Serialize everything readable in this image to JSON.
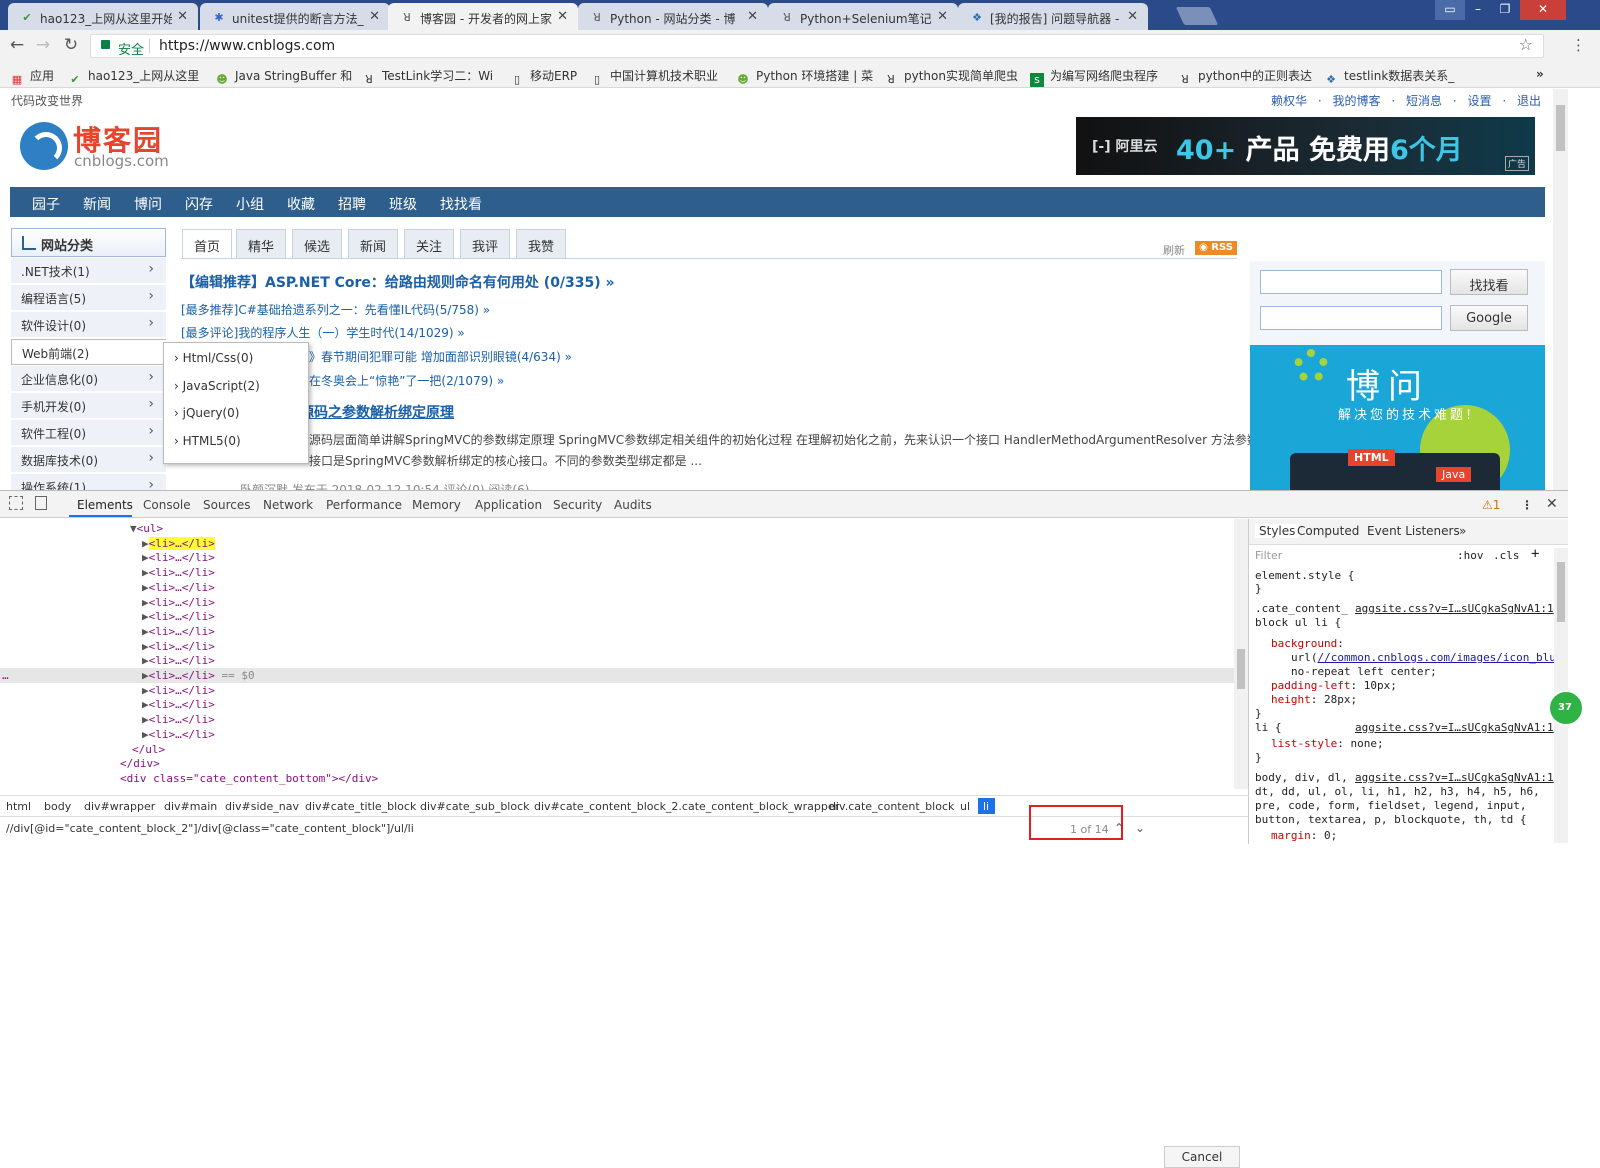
{
  "browser": {
    "tabs": [
      {
        "title": "hao123_上网从这里开始",
        "icon": "hao123-icon"
      },
      {
        "title": "unitest提供的断言方法_",
        "icon": "baidu-icon"
      },
      {
        "title": "博客园 - 开发者的网上家",
        "icon": "cnblogs-icon",
        "active": true
      },
      {
        "title": "Python - 网站分类 - 博",
        "icon": "cnblogs-icon"
      },
      {
        "title": "Python+Selenium笔记",
        "icon": "cnblogs-icon"
      },
      {
        "title": "[我的报告] 问题导航器 -",
        "icon": "testlink-icon"
      }
    ],
    "url_security": "安全",
    "url": "https://www.cnblogs.com",
    "bookmarks": [
      "应用",
      "hao123_上网从这里",
      "Java StringBuffer 和",
      "TestLink学习二：Wi",
      "移动ERP",
      "中国计算机技术职业",
      "Python 环境搭建 | 菜",
      "python实现简单爬虫",
      "为编写网络爬虫程序",
      "python中的正则表达",
      "testlink数据表关系_"
    ]
  },
  "site": {
    "slogan": "代码改变世界",
    "toplinks": [
      "赖权华",
      "·",
      "我的博客",
      "·",
      "短消息",
      "·",
      "设置",
      "·",
      "退出"
    ],
    "logo_text": "博客园",
    "logo_domain": "cnblogs.com",
    "ad": {
      "brand": "[-] 阿里云",
      "headline_num": "40+",
      "headline_text": " 产品 免费用",
      "headline_tail": "6个月",
      "tag": "广告"
    },
    "nav": [
      "园子",
      "新闻",
      "博问",
      "闪存",
      "小组",
      "收藏",
      "招聘",
      "班级",
      "找找看"
    ],
    "side": {
      "title": "网站分类",
      "items": [
        ".NET技术(1)",
        "编程语言(5)",
        "软件设计(0)",
        "Web前端(2)",
        "企业信息化(0)",
        "手机开发(0)",
        "软件工程(0)",
        "数据库技术(0)",
        "操作系统(1)"
      ],
      "submenu": [
        "Html/Css(0)",
        "JavaScript(2)",
        "jQuery(0)",
        "HTML5(0)"
      ]
    },
    "content_tabs": [
      "首页",
      "精华",
      "候选",
      "新闻",
      "关注",
      "我评",
      "我赞"
    ],
    "refresh": "刷新",
    "rss": "RSS",
    "headline": "【编辑推荐】ASP.NET Core：给路由规则命名有何用处 (0/335) »",
    "news": [
      "[最多推荐]C#基础拾遗系列之一：先看懂IL代码(5/758) »",
      "[最多评论]我的程序人生（一）学生时代(14/1029) »",
      "》春节期间犯罪可能 增加面部识别眼镜(4/634) »",
      "在冬奥会上“惊艳”了一把(2/1079) »"
    ],
    "post_title": "源码之参数解析绑定原理",
    "summary": [
      "源码层面简单讲解SpringMVC的参数绑定原理 SpringMVC参数绑定相关组件的初始化过程 在理解初始化之前，先来认识一个接口 HandlerMethodArgumentResolver 方法参数解析",
      "接口是SpringMVC参数解析绑定的核心接口。不同的参数类型绑定都是 ..."
    ],
    "meta": "卧颜沉默 发布于 2018-02-12 10:54  评论(0)  阅读(6)",
    "search_btn1": "找找看",
    "search_btn2": "Google",
    "bowen": {
      "title": "博问",
      "subtitle": "解决您的技术难题!",
      "tag1": "HTML",
      "tag2": "Java"
    }
  },
  "devtools": {
    "tabs": [
      "Elements",
      "Console",
      "Sources",
      "Network",
      "Performance",
      "Memory",
      "Application",
      "Security",
      "Audits"
    ],
    "warn_count": "1",
    "code_lines": [
      {
        "text": "<ul>",
        "indent": 1,
        "open": true
      },
      {
        "text": "<li>…</li>",
        "indent": 2,
        "hl": "yellow"
      },
      {
        "text": "<li>…</li>",
        "indent": 2
      },
      {
        "text": "<li>…</li>",
        "indent": 2
      },
      {
        "text": "<li>…</li>",
        "indent": 2
      },
      {
        "text": "<li>…</li>",
        "indent": 2
      },
      {
        "text": "<li>…</li>",
        "indent": 2
      },
      {
        "text": "<li>…</li>",
        "indent": 2
      },
      {
        "text": "<li>…</li>",
        "indent": 2
      },
      {
        "text": "<li>…</li>",
        "indent": 2
      },
      {
        "text": "<li>…</li> == $0",
        "indent": 2,
        "hl": "grey"
      },
      {
        "text": "<li>…</li>",
        "indent": 2
      },
      {
        "text": "<li>…</li>",
        "indent": 2
      },
      {
        "text": "<li>…</li>",
        "indent": 2
      },
      {
        "text": "<li>…</li>",
        "indent": 2
      },
      {
        "text": "</ul>",
        "indent": 1
      },
      {
        "text": "</div>",
        "indent": 0
      },
      {
        "text": "<div class=\"cate_content_bottom\"></div>",
        "indent": 0
      },
      {
        "text": "</div>",
        "indent": -1
      }
    ],
    "breadcrumbs": [
      "html",
      "body",
      "div#wrapper",
      "div#main",
      "div#side_nav",
      "div#cate_title_block",
      "div#cate_sub_block",
      "div#cate_content_block_2.cate_content_block_wrapper",
      "div.cate_content_block",
      "ul",
      "li"
    ],
    "xpath": "//div[@id=\"cate_content_block_2\"]/div[@class=\"cate_content_block\"]/ul/li",
    "match_count": "1 of 14",
    "cancel": "Cancel",
    "styles_tabs": [
      "Styles",
      "Computed",
      "Event Listeners",
      "»"
    ],
    "filter": "Filter",
    "hov": ":hov",
    "cls": ".cls",
    "style_lines": [
      "element.style {",
      "}",
      ".cate_content_",
      "block ul li {",
      "background:",
      "url(//common.cnblogs.com/images/icon_blu",
      "no-repeat left center;",
      "padding-left: 10px;",
      "height: 28px;",
      "}",
      "li {",
      "list-style: none;",
      "}",
      "body, div, dl,",
      "dt, dd, ul, ol, li, h1, h2, h3, h4, h5, h6,",
      "pre, code, form, fieldset, legend, input,",
      "button, textarea, p, blockquote, th, td {",
      "margin: 0;"
    ],
    "style_source": "aggsite.css?v=I…sUCgkaSgNvA1:1",
    "green_badge": "37"
  }
}
